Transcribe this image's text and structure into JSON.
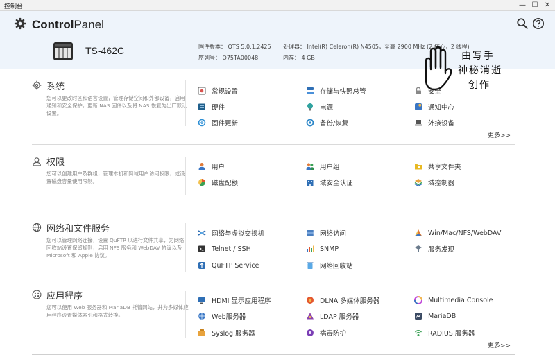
{
  "window": {
    "title": "控制台",
    "minimize": "—",
    "maximize": "☐",
    "close": "✕"
  },
  "header": {
    "brand_bold": "Control",
    "brand_light": "Panel",
    "icons": [
      "gear-icon",
      "search-icon",
      "help-icon"
    ],
    "model": "TS-462C",
    "firmware_label": "固件版本：",
    "firmware_value": "QTS 5.0.1.2425",
    "serial_label": "序列号：",
    "serial_value": "Q75TA00048",
    "cpu_label": "处理器：",
    "cpu_value": "Intel(R) Celeron(R) N4505，至高 2900 MHz (2 核心，2 线程)",
    "memory_label": "内存：",
    "memory_value": "4 GB"
  },
  "watermark": {
    "line1": "由写手",
    "line2": "神秘消逝",
    "line3": "创作"
  },
  "sections": [
    {
      "title": "系统",
      "icon": "gear-icon",
      "desc": "您可以更改时区和语言设置，管理存储空间和外部设备，启用通知和安全保护，更新 NAS 固件以及将 NAS 恢复为出厂默认设置。",
      "items": [
        {
          "label": "常规设置",
          "icon": "general-settings-icon",
          "color": "#d9534f"
        },
        {
          "label": "存储与快照总管",
          "icon": "storage-icon",
          "color": "#2f6fb5"
        },
        {
          "label": "安全",
          "icon": "lock-icon",
          "color": "#888888"
        },
        {
          "label": "硬件",
          "icon": "hardware-icon",
          "color": "#1f5f8b"
        },
        {
          "label": "电源",
          "icon": "power-icon",
          "color": "#2fa3a0"
        },
        {
          "label": "通知中心",
          "icon": "notification-icon",
          "color": "#3a76c4"
        },
        {
          "label": "固件更新",
          "icon": "firmware-icon",
          "color": "#2d8fd5"
        },
        {
          "label": "备份/恢复",
          "icon": "backup-icon",
          "color": "#2b86c8"
        },
        {
          "label": "外接设备",
          "icon": "external-device-icon",
          "color": "#555555"
        }
      ],
      "more": "更多>>"
    },
    {
      "title": "权限",
      "icon": "user-icon",
      "desc": "您可以创建用户及群组，管理本机和网域用户访问权限，或设置磁盘容量使用限制。",
      "items": [
        {
          "label": "用户",
          "icon": "user-icon",
          "color": "#e07b39"
        },
        {
          "label": "用户组",
          "icon": "user-group-icon",
          "color": "#e07b39"
        },
        {
          "label": "共享文件夹",
          "icon": "shared-folder-icon",
          "color": "#e8b923"
        },
        {
          "label": "磁盘配额",
          "icon": "quota-icon",
          "color": "#e4572e"
        },
        {
          "label": "域安全认证",
          "icon": "domain-security-icon",
          "color": "#2f6fb5"
        },
        {
          "label": "域控制器",
          "icon": "domain-controller-icon",
          "color": "#e8a33d"
        }
      ]
    },
    {
      "title": "网络和文件服务",
      "icon": "globe-icon",
      "desc": "您可以管理网络连接，设置 QuFTP 以进行文件共享，为网络回收站设置保留规则，启用 NFS 服务和 WebDAV 协议以及 Microsoft 和 Apple 协议。",
      "items": [
        {
          "label": "网络与虚拟交换机",
          "icon": "network-switch-icon",
          "color": "#2f6fb5"
        },
        {
          "label": "网络访问",
          "icon": "network-access-icon",
          "color": "#4a7fc1"
        },
        {
          "label": "Win/Mac/NFS/WebDAV",
          "icon": "file-protocol-icon",
          "color": "#e07b39"
        },
        {
          "label": "Telnet / SSH",
          "icon": "terminal-icon",
          "color": "#333333"
        },
        {
          "label": "SNMP",
          "icon": "snmp-icon",
          "color": "#3a76c4"
        },
        {
          "label": "服务发现",
          "icon": "service-discovery-icon",
          "color": "#6b7b8c"
        },
        {
          "label": "QuFTP Service",
          "icon": "ftp-icon",
          "color": "#2f6fb5"
        },
        {
          "label": "网络回收站",
          "icon": "recycle-bin-icon",
          "color": "#5aa9e6"
        }
      ]
    },
    {
      "title": "应用程序",
      "icon": "apps-icon",
      "desc": "您可以使用 Web 服务器和 MariaDB 托管网站，并为多媒体应用程序设置媒体索引和格式转换。",
      "items": [
        {
          "label": "HDMI 显示应用程序",
          "icon": "hdmi-icon",
          "color": "#2f6fb5"
        },
        {
          "label": "DLNA 多媒体服务器",
          "icon": "dlna-icon",
          "color": "#e4572e"
        },
        {
          "label": "Multimedia Console",
          "icon": "multimedia-icon",
          "color": "#c04bd8"
        },
        {
          "label": "Web服务器",
          "icon": "web-server-icon",
          "color": "#3a76c4"
        },
        {
          "label": "LDAP 服务器",
          "icon": "ldap-icon",
          "color": "#8e44ad"
        },
        {
          "label": "MariaDB",
          "icon": "database-icon",
          "color": "#3b4a63"
        },
        {
          "label": "Syslog 服务器",
          "icon": "syslog-icon",
          "color": "#e8a33d"
        },
        {
          "label": "病毒防护",
          "icon": "antivirus-icon",
          "color": "#7b3fb5"
        },
        {
          "label": "RADIUS 服务器",
          "icon": "radius-icon",
          "color": "#3aa055"
        }
      ],
      "more": "更多>>"
    }
  ]
}
